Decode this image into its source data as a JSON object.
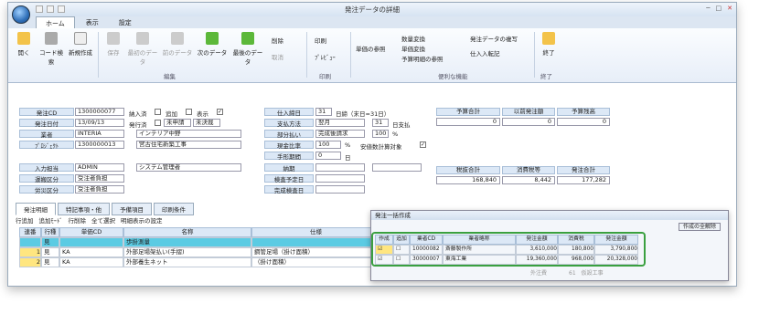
{
  "window": {
    "title": "発注データの詳細"
  },
  "tabs": [
    "ホーム",
    "表示",
    "設定"
  ],
  "ribbon": {
    "buttons": [
      "開く",
      "コード検索",
      "新規作成",
      "保存",
      "最初のデータ",
      "前のデータ",
      "次のデータ",
      "最後のデータ"
    ],
    "edit": [
      "削除",
      "取消"
    ],
    "print": [
      "印刷",
      "ﾌﾟﾚﾋﾞｭｰ"
    ],
    "ref": [
      "単価の参照",
      "数量変換",
      "単価変換",
      "予算明細の参照"
    ],
    "other": [
      "発注データの複写",
      "仕入入転記"
    ],
    "exit": "終了",
    "groups": [
      "編集",
      "印刷",
      "便利な機能",
      "終了"
    ]
  },
  "form": {
    "labels": [
      "発注CD",
      "発注日付",
      "業者",
      "ﾌﾟﾛｼﾞｪｸﾄ",
      "入力担当",
      "運搬区分",
      "労災区分"
    ],
    "order_cd": "1300000077",
    "nohin": "納入済",
    "tsuika": "追加",
    "hyoji": "表示",
    "date": "13/09/13",
    "hakko": "発行済",
    "mihakko": "未申請",
    "mikessai": "未決裁",
    "vendor_code": "INTERIA",
    "vendor_name": "インテリア中野",
    "project_code": "1300000013",
    "project_name": "宮古住宅新築工事",
    "staff_code": "ADMIN",
    "staff_name": "システム管理者",
    "transport": "受注者負担",
    "labor": "受注者負担",
    "right_labels": [
      "仕入締日",
      "支払方法",
      "部分払い",
      "現金比率",
      "手形期間",
      "納期",
      "検査予定日",
      "完成検査日"
    ],
    "shime": "31",
    "shime_note": "日締（末日=31日）",
    "pay": "翌月",
    "pay_day": "31",
    "pay_note": "日支払",
    "partial": "完成後請求",
    "partial_pct": "100",
    "pct": "%",
    "cash": "100",
    "cash_pct": "%",
    "safety": "安値数計算対象",
    "tegata": "0",
    "tegata_unit": "日",
    "totals_hdr": [
      "予算合計",
      "以前発注額",
      "予算残高"
    ],
    "totals": [
      "0",
      "0",
      "0"
    ],
    "tax_hdr": [
      "税抜合計",
      "消費税等",
      "発注合計"
    ],
    "tax": [
      "168,840",
      "8,442",
      "177,282"
    ]
  },
  "subtabs": [
    "発注明細",
    "特記事項・他",
    "予備項目",
    "印刷条件"
  ],
  "toolbar2": [
    "行追加",
    "追加ﾓｰﾄﾞ",
    "行削除",
    "全て選択",
    "明細表示の設定"
  ],
  "grid": {
    "headers": [
      "連番",
      "行種",
      "単価CD",
      "名称",
      "仕様"
    ],
    "rows": [
      {
        "no": "",
        "kind": "見",
        "code": "",
        "name": "歩掛測量",
        "spec": ""
      },
      {
        "no": "1",
        "kind": "見",
        "code": "KA",
        "name": "外部足場架払い(手摺)",
        "spec": "鋼管足場（掛け面積）"
      },
      {
        "no": "2",
        "kind": "見",
        "code": "KA",
        "name": "外部養生ネット",
        "spec": "（掛け面積）"
      }
    ]
  },
  "popup": {
    "title": "発注一括作成",
    "btn1": "作成の全解除",
    "headers": [
      "作成",
      "追加",
      "業者CD",
      "業者略称",
      "発注金額",
      "消費税",
      "発注金額"
    ],
    "rows": [
      {
        "code": "10000082",
        "name": "斎藤製作所",
        "amt": "3,610,000",
        "tax": "180,800",
        "total": "3,790,800"
      },
      {
        "code": "30000007",
        "name": "東海工業",
        "amt": "19,360,000",
        "tax": "968,000",
        "total": "20,328,000"
      }
    ],
    "bg_text": "外注費　　　　61　仮設工事"
  }
}
